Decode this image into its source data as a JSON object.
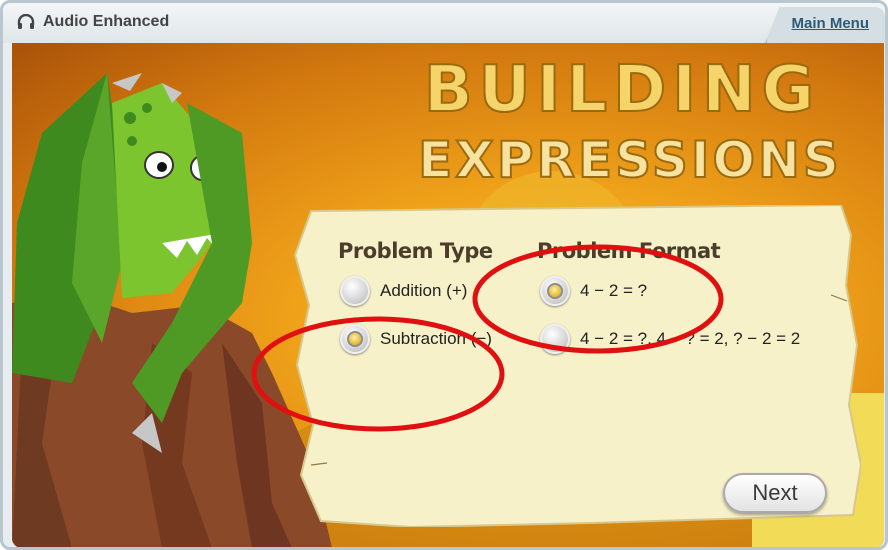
{
  "header": {
    "audio_label": "Audio Enhanced",
    "main_menu_label": "Main Menu",
    "audio_icon": "headphones-icon"
  },
  "title": {
    "line1": "BUILDING",
    "line2": "EXPRESSIONS"
  },
  "problem_type": {
    "heading": "Problem Type",
    "options": [
      {
        "label": "Addition (+)",
        "selected": false
      },
      {
        "label": "Subtraction (−)",
        "selected": true
      }
    ]
  },
  "problem_format": {
    "heading": "Problem Format",
    "options": [
      {
        "label": "4 − 2 = ?",
        "selected": true
      },
      {
        "label": "4 − 2 = ?, 4 − ? = 2, ? − 2 = 2",
        "selected": false
      }
    ]
  },
  "next_label": "Next",
  "colors": {
    "background_orange": "#eea019",
    "parchment": "#f6f1c9",
    "title_yellow": "#f5d56a",
    "annotation_red": "#e01010",
    "link_blue": "#2d5b77"
  }
}
